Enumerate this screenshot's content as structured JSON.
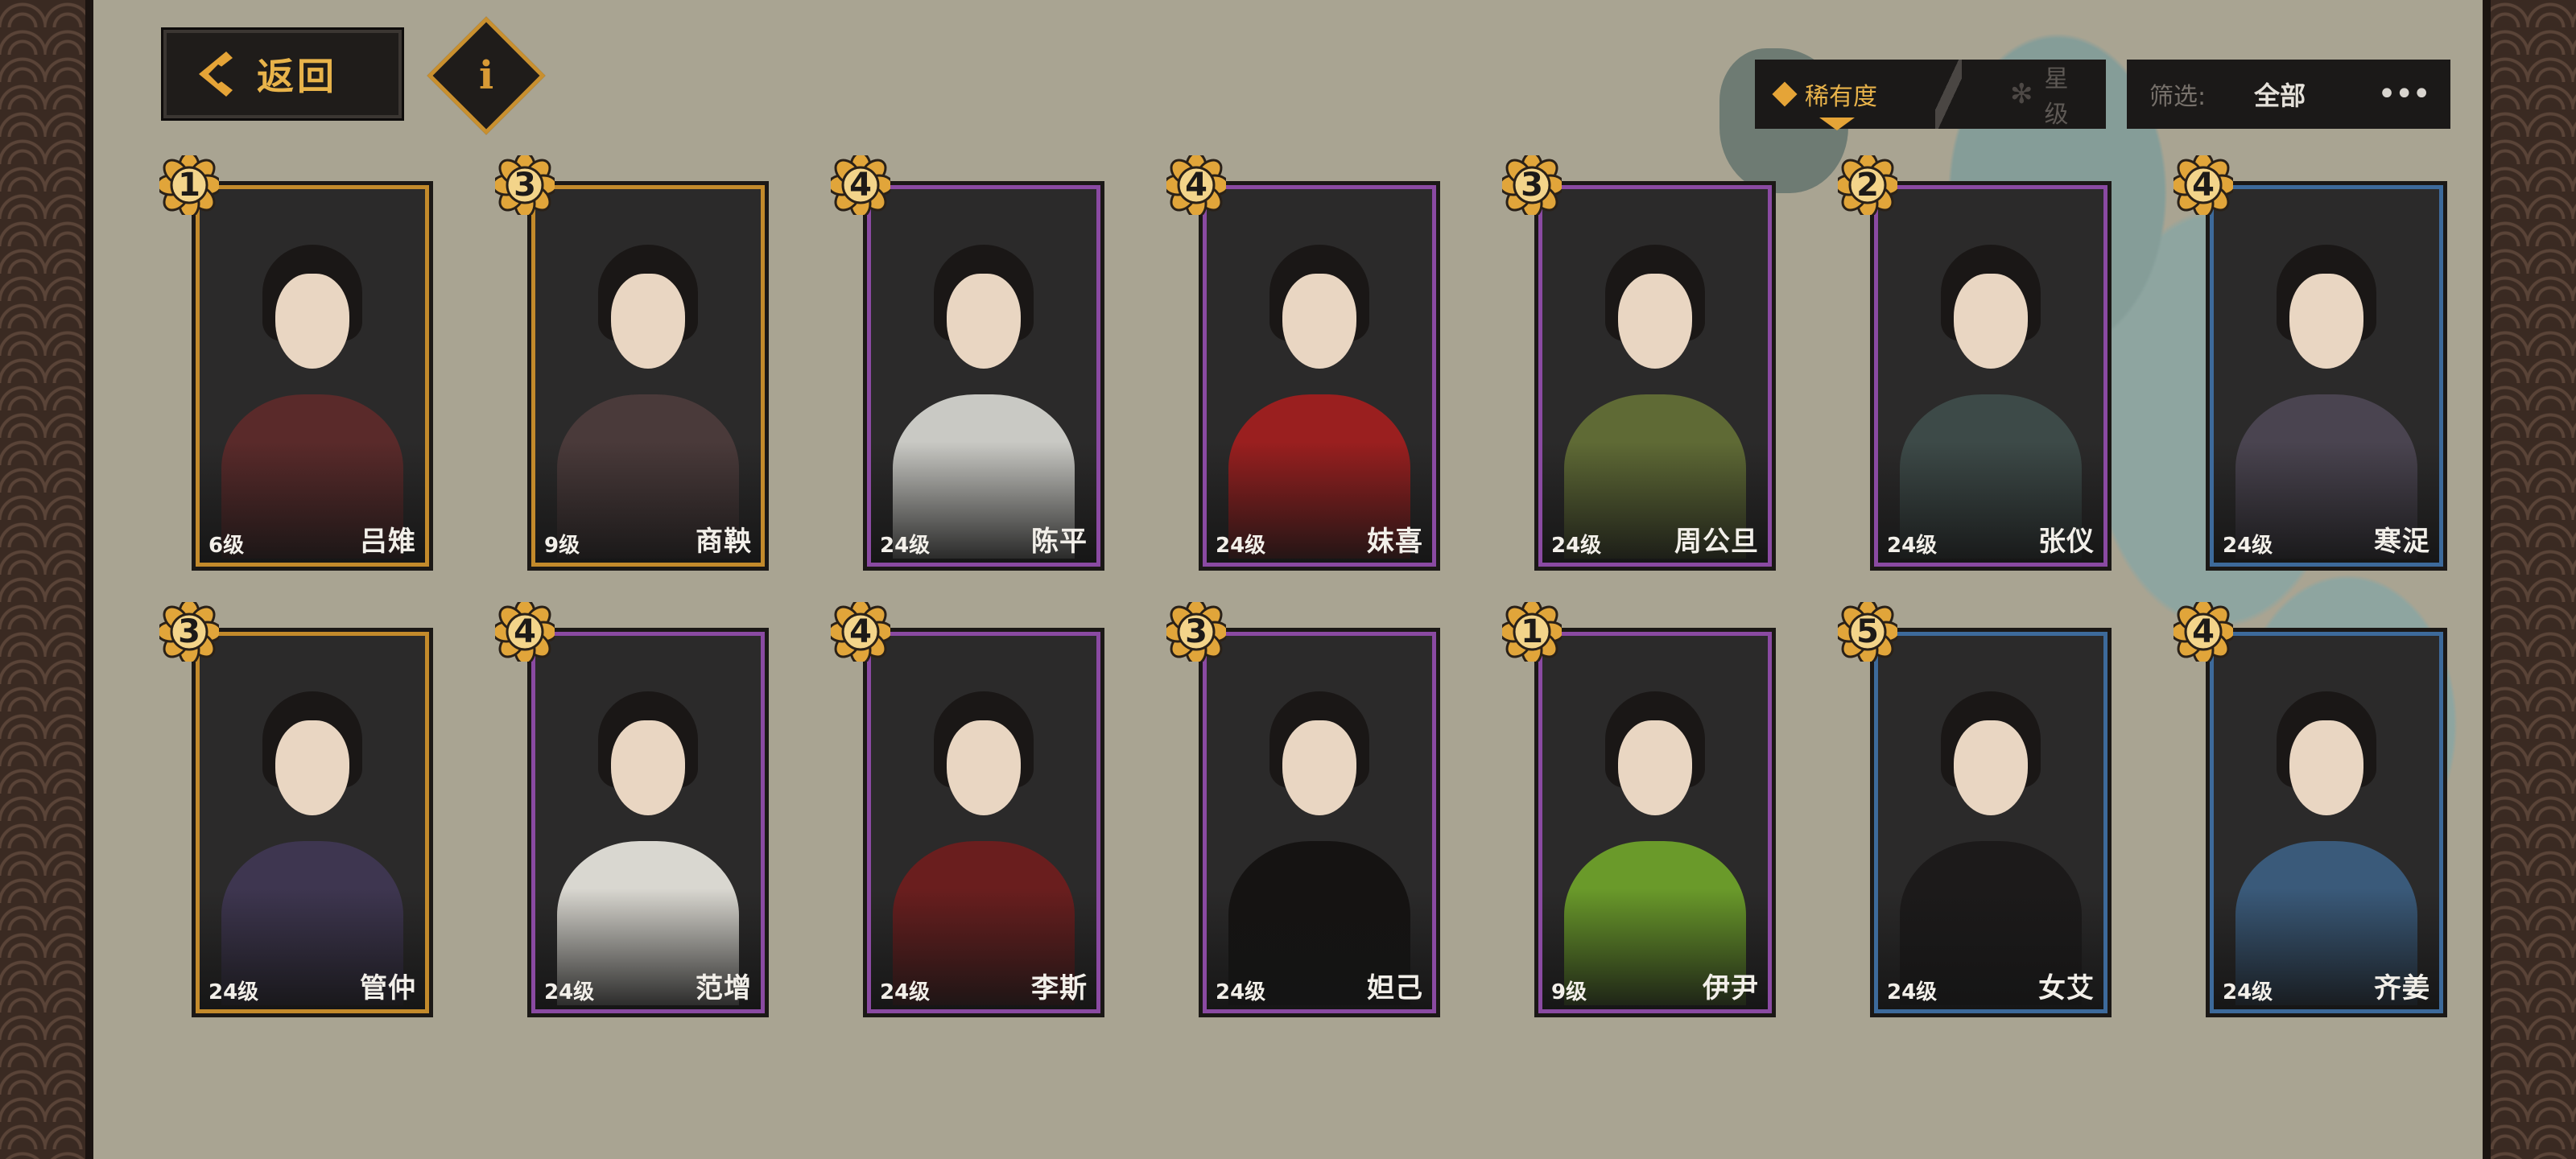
{
  "nav": {
    "back_label": "返回",
    "info_glyph": "i"
  },
  "sort": {
    "options": [
      {
        "label": "稀有度",
        "active": true
      },
      {
        "label": "星级",
        "active": false
      }
    ]
  },
  "filter": {
    "label": "筛选:",
    "value": "全部",
    "more": "•••"
  },
  "cards": [
    {
      "name": "吕雉",
      "level": "6级",
      "stars": "1",
      "frame": "gold"
    },
    {
      "name": "商鞅",
      "level": "9级",
      "stars": "3",
      "frame": "gold"
    },
    {
      "name": "陈平",
      "level": "24级",
      "stars": "4",
      "frame": "purple"
    },
    {
      "name": "妺喜",
      "level": "24级",
      "stars": "4",
      "frame": "purple"
    },
    {
      "name": "周公旦",
      "level": "24级",
      "stars": "3",
      "frame": "purple"
    },
    {
      "name": "张仪",
      "level": "24级",
      "stars": "2",
      "frame": "purple"
    },
    {
      "name": "寒浞",
      "level": "24级",
      "stars": "4",
      "frame": "blue"
    },
    {
      "name": "管仲",
      "level": "24级",
      "stars": "3",
      "frame": "gold"
    },
    {
      "name": "范增",
      "level": "24级",
      "stars": "4",
      "frame": "purple"
    },
    {
      "name": "李斯",
      "level": "24级",
      "stars": "4",
      "frame": "purple"
    },
    {
      "name": "妲己",
      "level": "24级",
      "stars": "3",
      "frame": "purple"
    },
    {
      "name": "伊尹",
      "level": "9级",
      "stars": "1",
      "frame": "purple"
    },
    {
      "name": "女艾",
      "level": "24级",
      "stars": "5",
      "frame": "blue"
    },
    {
      "name": "齐姜",
      "level": "24级",
      "stars": "4",
      "frame": "blue"
    }
  ],
  "colors": {
    "gold_frame": "#c38a2b",
    "purple_frame": "#8a4aa2",
    "blue_frame": "#3d6a9b",
    "accent": "#e9b34a"
  },
  "icons": {
    "back": "chevron-left-icon",
    "info": "info-icon",
    "sort_active": "diamond-icon",
    "sort_inactive": "star-icon",
    "more": "ellipsis-icon",
    "star_badge": "flower-badge-icon"
  }
}
